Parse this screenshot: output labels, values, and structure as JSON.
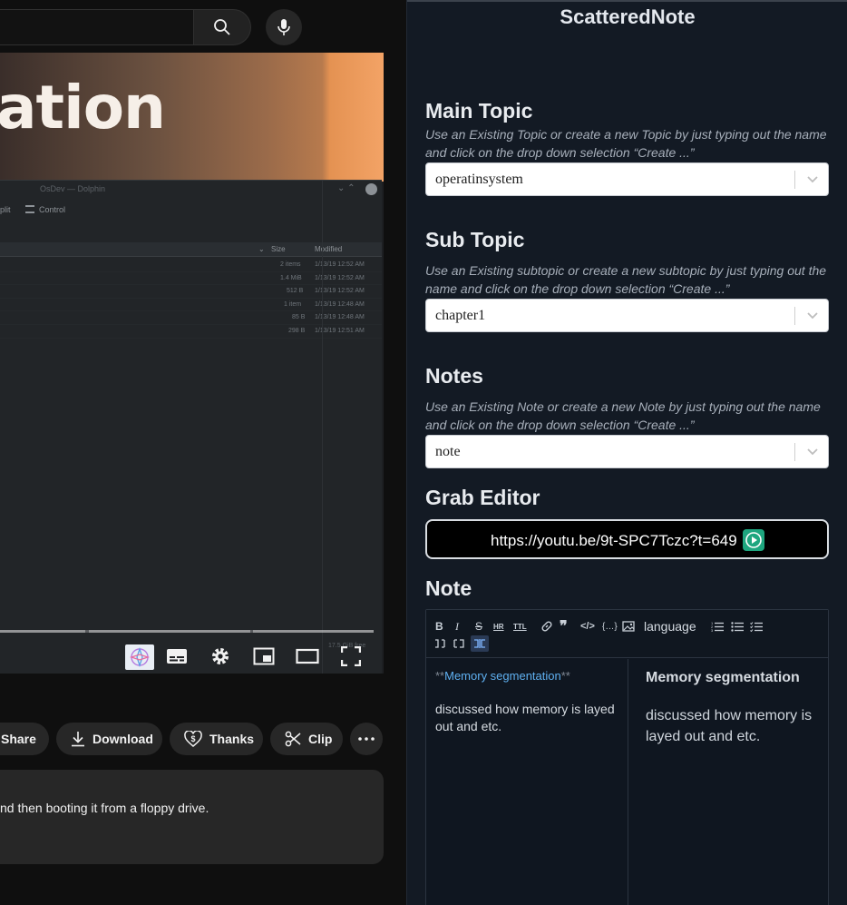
{
  "youtube": {
    "search": {
      "placeholder": ""
    },
    "video": {
      "banner_title": "ation",
      "window_title": "OsDev — Dolphin",
      "toolbar": {
        "split_label": "plit",
        "control_label": "Control"
      },
      "file_columns": {
        "size": "Size",
        "modified": "Modified"
      },
      "files": [
        {
          "size": "2 items",
          "modified": "1/13/19 12:52 AM"
        },
        {
          "size": "1.4 MiB",
          "modified": "1/13/19 12:52 AM"
        },
        {
          "size": "512 B",
          "modified": "1/13/19 12:52 AM"
        },
        {
          "size": "1 item",
          "modified": "1/13/19 12:48 AM"
        },
        {
          "size": "85 B",
          "modified": "1/13/19 12:48 AM"
        },
        {
          "size": "298 B",
          "modified": "1/13/19 12:51 AM"
        }
      ],
      "free_space": "17.5 GiB free"
    },
    "actions": {
      "share": "Share",
      "download": "Download",
      "thanks": "Thanks",
      "clip": "Clip"
    },
    "description_text": "nd then booting it from a floppy drive."
  },
  "panel": {
    "app_title": "ScatteredNote",
    "main_topic": {
      "heading": "Main Topic",
      "hint": "Use an Existing Topic or create a new Topic by just typing out the name and click on the drop down selection “Create ...”",
      "value": "operatinsystem"
    },
    "sub_topic": {
      "heading": "Sub Topic",
      "hint": "Use an Existing subtopic or create a new subtopic by just typing out the name and click on the drop down selection “Create ...”",
      "value": "chapter1"
    },
    "notes": {
      "heading": "Notes",
      "hint": "Use an Existing Note or create a new Note by just typing out the name and click on the drop down selection “Create ...”",
      "value": "note"
    },
    "grab_editor": {
      "heading": "Grab Editor",
      "url": "https://youtu.be/9t-SPC7Tczc?t=649"
    },
    "note": {
      "heading": "Note",
      "toolbar_language": "language",
      "markdown": {
        "prefix": "**",
        "heading_text": "Memory segmentation",
        "suffix": "**",
        "body": "discussed how memory is layed out and etc."
      },
      "preview": {
        "heading": "Memory segmentation",
        "body": "discussed how memory is layed out and etc."
      }
    }
  }
}
